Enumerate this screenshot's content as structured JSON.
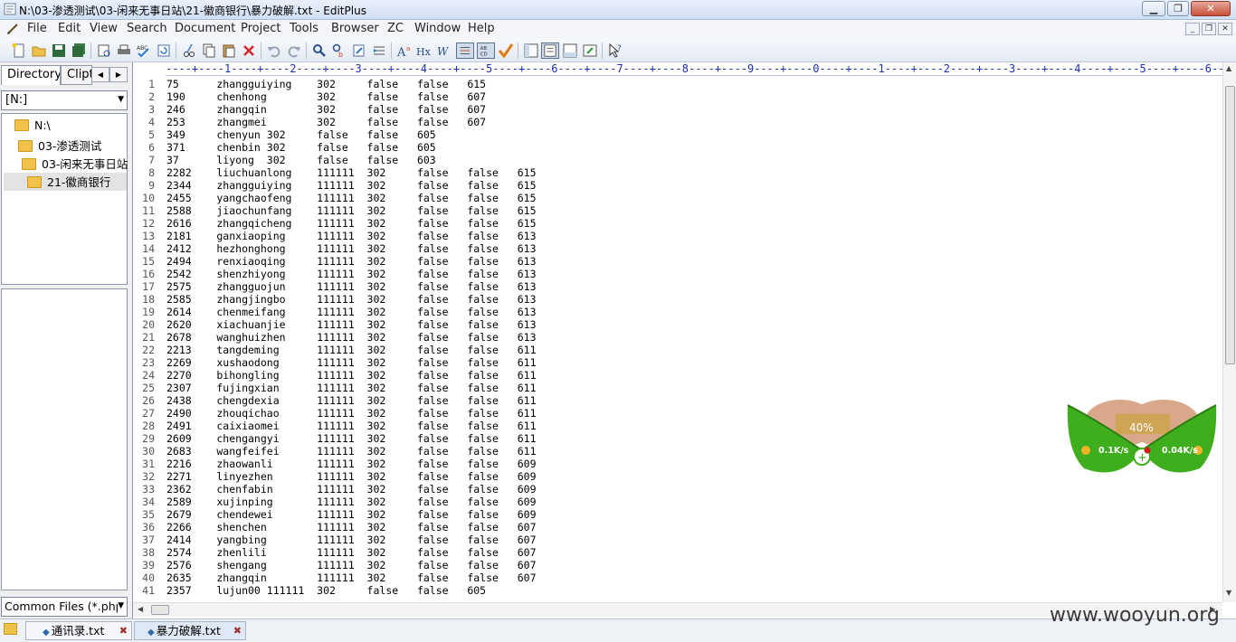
{
  "window": {
    "title": "N:\\03-渗透测试\\03-闲来无事日站\\21-徽商银行\\暴力破解.txt - EditPlus"
  },
  "menu": [
    "File",
    "Edit",
    "View",
    "Search",
    "Document",
    "Project",
    "Tools",
    "Browser",
    "ZC",
    "Window",
    "Help"
  ],
  "left_panel": {
    "tabs": [
      "Directory",
      "Clipt"
    ],
    "drive": "[N:]",
    "tree": [
      "N:\\",
      "03-渗透测试",
      "03-闲来无事日站",
      "21-徽商银行"
    ],
    "filter": "Common Files (*.php"
  },
  "editor": {
    "ruler": "----+----1----+----2----+----3----+----4----+----5----+----6----+----7----+----8----+----9----+----0----+----1----+----2----+----3----+----4----+----5----+----6----+",
    "lines": [
      "75\tzhangguiying\t302\tfalse\tfalse\t615",
      "190\tchenhong\t302\tfalse\tfalse\t607",
      "246\tzhangqin\t302\tfalse\tfalse\t607",
      "253\tzhangmei\t302\tfalse\tfalse\t607",
      "349\tchenyun 302\tfalse\tfalse\t605",
      "371\tchenbin 302\tfalse\tfalse\t605",
      "37\tliyong  302\tfalse\tfalse\t603",
      "2282\tliuchuanlong\t111111\t302\tfalse\tfalse\t615",
      "2344\tzhangguiying\t111111\t302\tfalse\tfalse\t615",
      "2455\tyangchaofeng\t111111\t302\tfalse\tfalse\t615",
      "2588\tjiaochunfang\t111111\t302\tfalse\tfalse\t615",
      "2616\tzhangqicheng\t111111\t302\tfalse\tfalse\t615",
      "2181\tganxiaoping\t111111\t302\tfalse\tfalse\t613",
      "2412\thezhonghong\t111111\t302\tfalse\tfalse\t613",
      "2494\trenxiaoqing\t111111\t302\tfalse\tfalse\t613",
      "2542\tshenzhiyong\t111111\t302\tfalse\tfalse\t613",
      "2575\tzhangguojun\t111111\t302\tfalse\tfalse\t613",
      "2585\tzhangjingbo\t111111\t302\tfalse\tfalse\t613",
      "2614\tchenmeifang\t111111\t302\tfalse\tfalse\t613",
      "2620\txiachuanjie\t111111\t302\tfalse\tfalse\t613",
      "2678\twanghuizhen\t111111\t302\tfalse\tfalse\t613",
      "2213\ttangdeming\t111111\t302\tfalse\tfalse\t611",
      "2269\txushaodong\t111111\t302\tfalse\tfalse\t611",
      "2270\tbihongling\t111111\t302\tfalse\tfalse\t611",
      "2307\tfujingxian\t111111\t302\tfalse\tfalse\t611",
      "2438\tchengdexia\t111111\t302\tfalse\tfalse\t611",
      "2490\tzhouqichao\t111111\t302\tfalse\tfalse\t611",
      "2491\tcaixiaomei\t111111\t302\tfalse\tfalse\t611",
      "2609\tchengangyi\t111111\t302\tfalse\tfalse\t611",
      "2683\twangfeifei\t111111\t302\tfalse\tfalse\t611",
      "2216\tzhaowanli\t111111\t302\tfalse\tfalse\t609",
      "2271\tlinyezhen\t111111\t302\tfalse\tfalse\t609",
      "2362\tchenfabin\t111111\t302\tfalse\tfalse\t609",
      "2589\txujinping\t111111\t302\tfalse\tfalse\t609",
      "2679\tchendewei\t111111\t302\tfalse\tfalse\t609",
      "2266\tshenchen\t111111\t302\tfalse\tfalse\t607",
      "2414\tyangbing\t111111\t302\tfalse\tfalse\t607",
      "2574\tzhenlili\t111111\t302\tfalse\tfalse\t607",
      "2576\tshengang\t111111\t302\tfalse\tfalse\t607",
      "2635\tzhangqin\t111111\t302\tfalse\tfalse\t607",
      "2357\tlujun00 111111\t302\tfalse\tfalse\t605"
    ]
  },
  "doc_tabs": [
    {
      "label": "通讯录.txt",
      "active": false
    },
    {
      "label": "暴力破解.txt",
      "active": true
    }
  ],
  "net_widget": {
    "percent": "40%",
    "upload": "0.1K/s",
    "download": "0.04K/s"
  },
  "watermark": "www.wooyun.org",
  "colors": {
    "ruler": "#1c2fb5",
    "widget_green": "#3fae1c"
  }
}
